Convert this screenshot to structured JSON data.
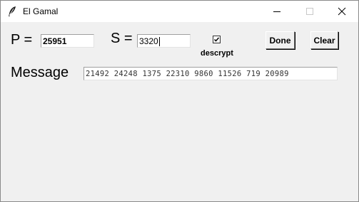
{
  "window": {
    "title": "El Gamal",
    "controls": {
      "minimize_icon": "minimize-icon",
      "maximize_icon": "maximize-icon",
      "close_icon": "close-icon"
    }
  },
  "form": {
    "p_label": "P =",
    "p_value": "25951",
    "s_label": "S =",
    "s_value": "3320",
    "decrypt_checkbox": {
      "label": "descrypt",
      "checked": true
    },
    "done_label": "Done",
    "clear_label": "Clear",
    "message_label": "Message",
    "message_value": "21492 24248 1375 22310 9860 11526 719 20989"
  }
}
